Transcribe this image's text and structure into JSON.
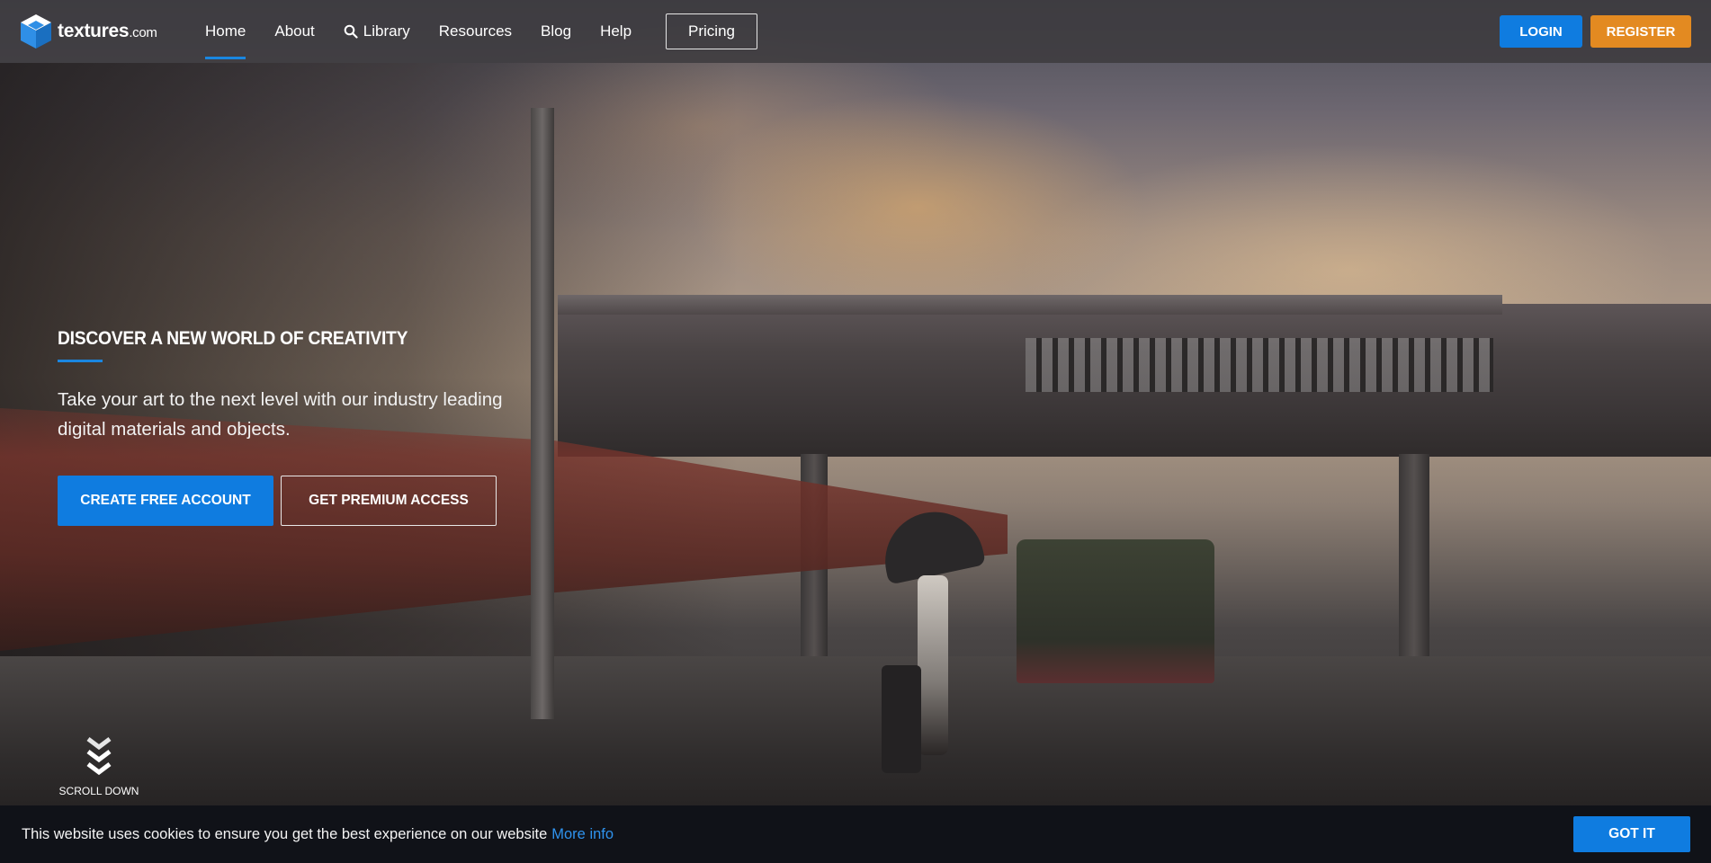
{
  "brand": {
    "name": "textures",
    "suffix": ".com",
    "logo_icon": "cube-logo-icon"
  },
  "nav": {
    "items": [
      {
        "label": "Home",
        "active": true
      },
      {
        "label": "About"
      },
      {
        "label": "Library",
        "icon": "search-icon"
      },
      {
        "label": "Resources"
      },
      {
        "label": "Blog"
      },
      {
        "label": "Help"
      }
    ],
    "pricing_label": "Pricing"
  },
  "auth": {
    "login_label": "LOGIN",
    "register_label": "REGISTER"
  },
  "hero": {
    "title": "DISCOVER A NEW WORLD OF CREATIVITY",
    "subtitle_line1": "Take your art to the next level with our industry leading",
    "subtitle_line2": "digital materials and objects.",
    "primary_cta": "CREATE FREE ACCOUNT",
    "secondary_cta": "GET PREMIUM ACCESS",
    "scroll_label": "SCROLL DOWN",
    "scroll_icon": "double-chevron-down-icon"
  },
  "cookie": {
    "message": "This website uses cookies to ensure you get the best experience on our website",
    "more_info": "More info",
    "accept_label": "GOT IT"
  },
  "colors": {
    "accent_blue": "#0f7ce0",
    "register_orange": "#e38a21",
    "cookie_bg": "#101218"
  }
}
